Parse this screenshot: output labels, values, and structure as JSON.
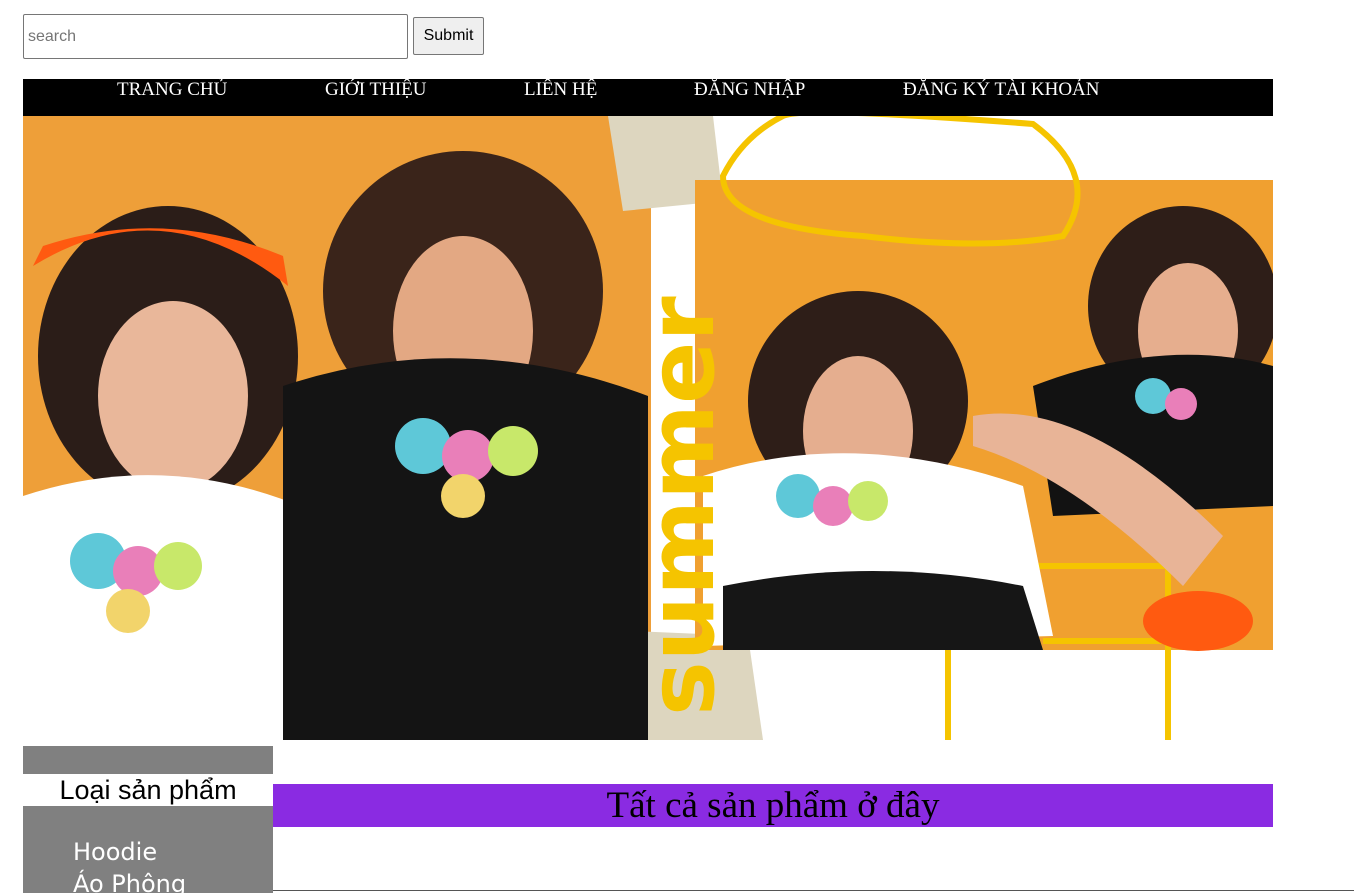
{
  "search": {
    "placeholder": "search",
    "value": "",
    "submit_label": "Submit"
  },
  "nav": {
    "items": [
      {
        "label": "TRANG CHỦ"
      },
      {
        "label": "GIỚI THIỆU"
      },
      {
        "label": "LIÊN HỆ"
      },
      {
        "label": "ĐĂNG NHẬP"
      },
      {
        "label": "ĐĂNG KÝ TÀI KHOẢN"
      }
    ]
  },
  "banner": {
    "text": "summer"
  },
  "sidebar": {
    "title": "Loại sản phẩm",
    "items": [
      {
        "label": "Hoodie"
      },
      {
        "label": "Áo Phông"
      }
    ]
  },
  "products": {
    "heading": "Tất cả sản phẩm ở đây"
  },
  "colors": {
    "nav_bg": "#000000",
    "products_header_bg": "#8a2be2",
    "sidebar_bg": "#808080",
    "banner_orange": "#f0a030",
    "banner_yellow": "#f5c400"
  }
}
